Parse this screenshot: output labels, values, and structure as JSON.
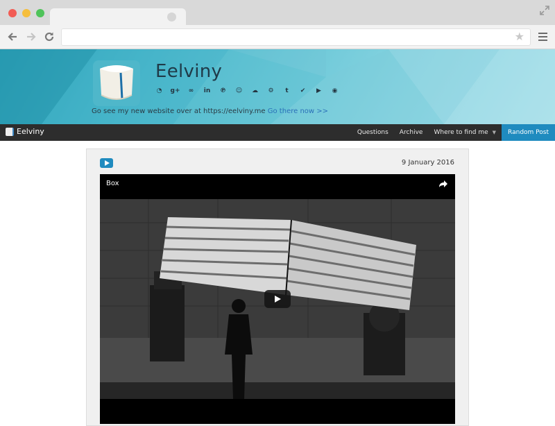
{
  "browser": {
    "url": ""
  },
  "header": {
    "title": "Eelviny",
    "social_icons": [
      "github-icon",
      "google-plus-icon",
      "lastfm-icon",
      "linkedin-icon",
      "pinterest-icon",
      "reddit-icon",
      "soundcloud-icon",
      "steam-icon",
      "tumblr-icon",
      "twitter-icon",
      "youtube-icon",
      "rss-icon"
    ],
    "social_glyphs": [
      "◔",
      "g+",
      "∞",
      "in",
      "℗",
      "☺",
      "☁",
      "⚙",
      "t",
      "✔",
      "▶",
      "◉"
    ],
    "notice_text": "Go see my new website over at https://eelviny.me",
    "notice_link": "Go there now >>"
  },
  "navbar": {
    "brand": "Eelviny",
    "links": [
      "Questions",
      "Archive",
      "Where to find me"
    ],
    "random_post": "Random Post"
  },
  "post": {
    "date": "9 January 2016",
    "video_title": "Box"
  }
}
